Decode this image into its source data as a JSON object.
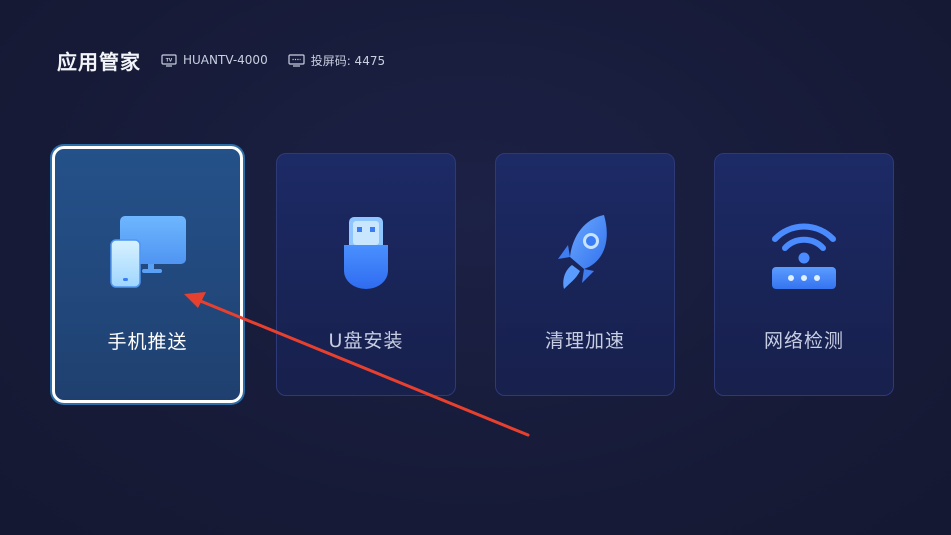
{
  "header": {
    "title": "应用管家",
    "device_name": "HUANTV-4000",
    "cast_code": "投屏码: 4475",
    "device_icon": "tv-icon",
    "cast_icon": "screen-cast-icon"
  },
  "cards": [
    {
      "label": "手机推送",
      "icon": "phone-monitor-icon",
      "focused": true
    },
    {
      "label": "U盘安装",
      "icon": "usb-drive-icon",
      "focused": false
    },
    {
      "label": "清理加速",
      "icon": "rocket-icon",
      "focused": false
    },
    {
      "label": "网络检测",
      "icon": "wifi-router-icon",
      "focused": false
    }
  ],
  "colors": {
    "background": "#171b38",
    "card": "#1b2760",
    "card_focused": "#23497e",
    "focus_border": "#ffffff",
    "icon_blue": "#3a7cf5",
    "annotation_arrow": "#e8402f"
  }
}
